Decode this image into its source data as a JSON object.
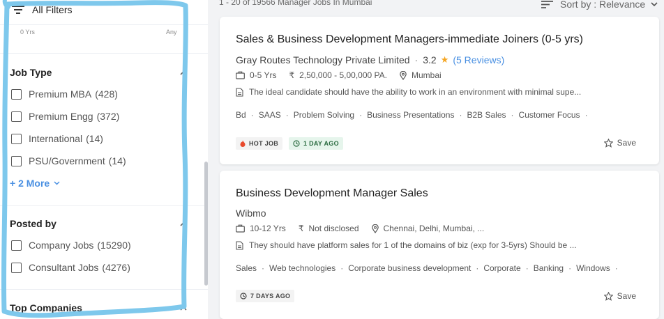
{
  "sidebar": {
    "title": "All Filters",
    "experience_range": {
      "min_label": "0 Yrs",
      "max_label": "Any"
    },
    "job_type": {
      "title": "Job Type",
      "options": [
        {
          "label": "Premium MBA",
          "count": "(428)"
        },
        {
          "label": "Premium Engg",
          "count": "(372)"
        },
        {
          "label": "International",
          "count": "(14)"
        },
        {
          "label": "PSU/Government",
          "count": "(14)"
        }
      ],
      "more_label": "+ 2 More"
    },
    "posted_by": {
      "title": "Posted by",
      "options": [
        {
          "label": "Company Jobs",
          "count": "(15290)"
        },
        {
          "label": "Consultant Jobs",
          "count": "(4276)"
        }
      ]
    },
    "top_companies": {
      "title": "Top Companies"
    }
  },
  "header": {
    "result_count": "1 - 20 of 19566  Manager Jobs In Mumbai",
    "sort_label": "Sort by : Relevance"
  },
  "jobs": [
    {
      "title": "Sales & Business Development Managers-immediate Joiners (0-5 yrs)",
      "company": "Gray Routes Technology Private Limited",
      "rating": "3.2",
      "reviews": "(5 Reviews)",
      "experience": "0-5 Yrs",
      "salary": "2,50,000 - 5,00,000 PA.",
      "location": "Mumbai",
      "description": "The ideal candidate should have the ability to work in an environment with minimal supe...",
      "tags": [
        "Bd",
        "SAAS",
        "Problem Solving",
        "Business Presentations",
        "B2B Sales",
        "Customer Focus"
      ],
      "badges": [
        "HOT JOB",
        "1 DAY AGO"
      ],
      "save_label": "Save"
    },
    {
      "title": "Business Development Manager Sales",
      "company": "Wibmo",
      "experience": "10-12 Yrs",
      "salary": "Not disclosed",
      "location": "Chennai, Delhi, Mumbai, ...",
      "description": "They should have platform sales for 1 of the domains of biz (exp for 3-5yrs) Should be ...",
      "tags": [
        "Sales",
        "Web technologies",
        "Corporate business development",
        "Corporate",
        "Banking",
        "Windows"
      ],
      "badges": [
        "7 DAYS AGO"
      ],
      "save_label": "Save"
    }
  ],
  "colors": {
    "accent_blue": "#4a90e2",
    "annotation_outline": "#7ec8ec",
    "star": "#f5a623",
    "hot_flame": "#e8492c",
    "fresh_badge_bg": "#e6f5ec"
  },
  "icons": [
    "filter-icon",
    "chevron-up-icon",
    "chevron-down-icon",
    "sort-icon",
    "briefcase-icon",
    "rupee-icon",
    "location-pin-icon",
    "document-icon",
    "flame-icon",
    "clock-icon",
    "star-outline-icon",
    "star-filled-icon"
  ]
}
